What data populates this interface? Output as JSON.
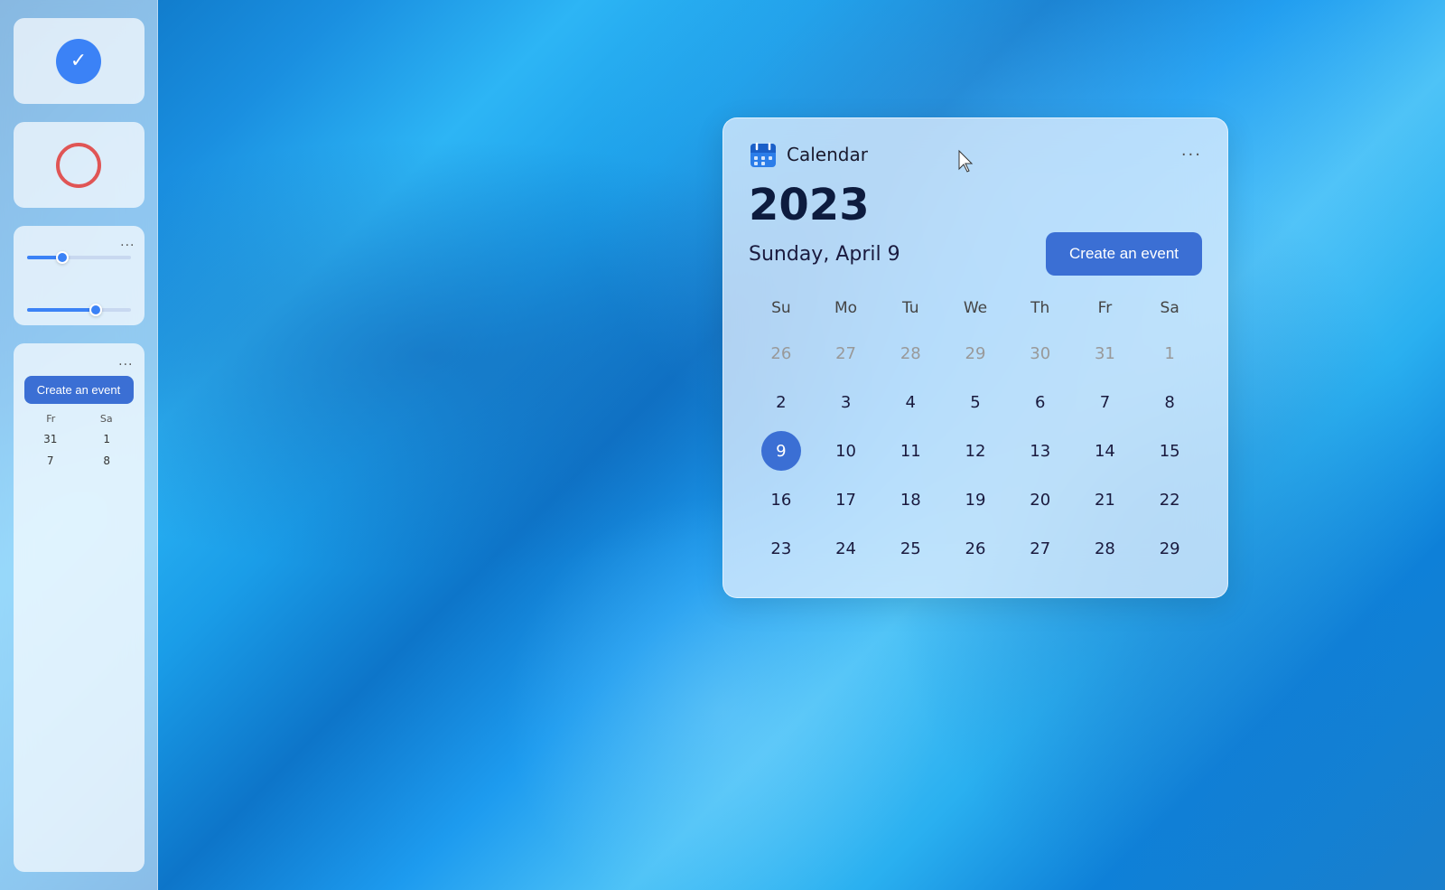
{
  "wallpaper": {
    "alt": "Windows 11 blue wave wallpaper"
  },
  "sidebar": {
    "dots_label": "...",
    "create_event_small": "Create an event",
    "mini_cal_headers": [
      "Fr",
      "Sa"
    ],
    "mini_cal_rows": [
      [
        "31",
        "1"
      ],
      [
        "7",
        "8"
      ]
    ]
  },
  "calendar_widget": {
    "app_name": "Calendar",
    "more_dots": "···",
    "year": "2023",
    "full_date": "Sunday, April 9",
    "create_event_label": "Create an event",
    "day_headers": [
      "Su",
      "Mo",
      "Tu",
      "We",
      "Th",
      "Fr",
      "Sa"
    ],
    "rows": [
      [
        {
          "num": "26",
          "type": "other"
        },
        {
          "num": "27",
          "type": "other"
        },
        {
          "num": "28",
          "type": "other"
        },
        {
          "num": "29",
          "type": "other"
        },
        {
          "num": "30",
          "type": "other"
        },
        {
          "num": "31",
          "type": "other"
        },
        {
          "num": "1",
          "type": "other"
        }
      ],
      [
        {
          "num": "2",
          "type": "normal"
        },
        {
          "num": "3",
          "type": "normal"
        },
        {
          "num": "4",
          "type": "normal"
        },
        {
          "num": "5",
          "type": "normal"
        },
        {
          "num": "6",
          "type": "normal"
        },
        {
          "num": "7",
          "type": "normal"
        },
        {
          "num": "8",
          "type": "normal"
        }
      ],
      [
        {
          "num": "9",
          "type": "today"
        },
        {
          "num": "10",
          "type": "normal"
        },
        {
          "num": "11",
          "type": "normal"
        },
        {
          "num": "12",
          "type": "normal"
        },
        {
          "num": "13",
          "type": "normal"
        },
        {
          "num": "14",
          "type": "normal"
        },
        {
          "num": "15",
          "type": "normal"
        }
      ],
      [
        {
          "num": "16",
          "type": "normal"
        },
        {
          "num": "17",
          "type": "normal"
        },
        {
          "num": "18",
          "type": "normal"
        },
        {
          "num": "19",
          "type": "normal"
        },
        {
          "num": "20",
          "type": "normal"
        },
        {
          "num": "21",
          "type": "normal"
        },
        {
          "num": "22",
          "type": "normal"
        }
      ],
      [
        {
          "num": "23",
          "type": "normal"
        },
        {
          "num": "24",
          "type": "normal"
        },
        {
          "num": "25",
          "type": "normal"
        },
        {
          "num": "26",
          "type": "normal"
        },
        {
          "num": "27",
          "type": "normal"
        },
        {
          "num": "28",
          "type": "normal"
        },
        {
          "num": "29",
          "type": "normal"
        }
      ]
    ],
    "colors": {
      "today_bg": "#3b6fd4",
      "create_event_bg": "#3b6fd4"
    }
  }
}
